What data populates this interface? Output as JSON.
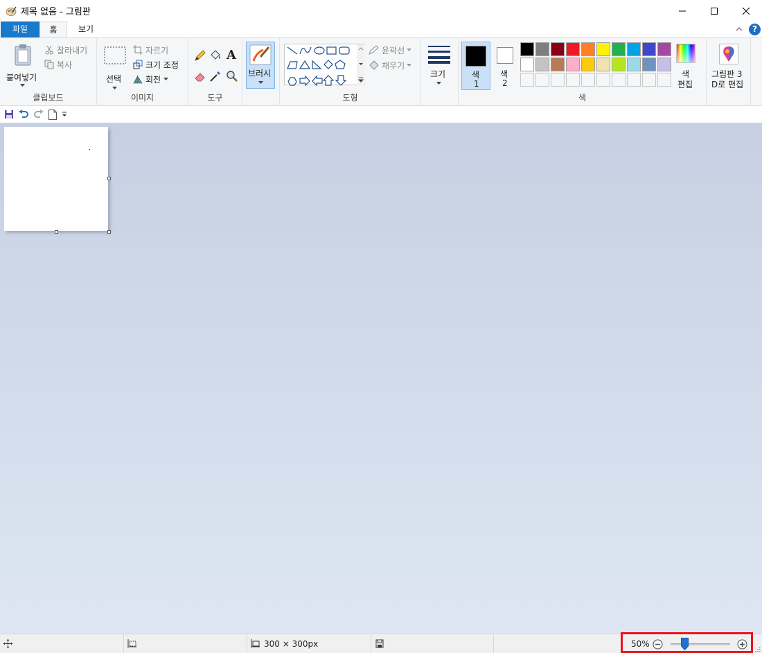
{
  "window": {
    "title": "제목 없음 - 그림판",
    "minimize_label": "—",
    "maximize_label": "☐",
    "close_label": "✕"
  },
  "tabs": [
    {
      "label": "파일"
    },
    {
      "label": "홈"
    },
    {
      "label": "보기"
    }
  ],
  "ribbon": {
    "clipboard": {
      "paste_label": "붙여넣기",
      "cut_label": "잘라내기",
      "copy_label": "복사",
      "group_label": "클립보드"
    },
    "image": {
      "select_label": "선택",
      "crop_label": "자르기",
      "resize_label": "크기 조정",
      "rotate_label": "회전",
      "group_label": "이미지"
    },
    "tools": {
      "text_label": "A",
      "group_label": "도구"
    },
    "brush": {
      "label": "브러시"
    },
    "shapes": {
      "outline_label": "윤곽선",
      "fill_label": "채우기",
      "group_label": "도형"
    },
    "size": {
      "label": "크기"
    },
    "colors": {
      "color1_label_a": "색",
      "color1_label_b": "1",
      "color2_label_a": "색",
      "color2_label_b": "2",
      "edit_colors_label_a": "색",
      "edit_colors_label_b": "편집",
      "group_label": "색",
      "color1_value": "#000000",
      "color2_value": "#ffffff",
      "palette_row1": [
        "#000000",
        "#7f7f7f",
        "#880015",
        "#ed1c24",
        "#ff7f27",
        "#fff200",
        "#22b14c",
        "#00a2e8",
        "#3f48cc",
        "#a349a4"
      ],
      "palette_row2": [
        "#ffffff",
        "#c3c3c3",
        "#b97a57",
        "#ffaec9",
        "#ffc90e",
        "#efe4b0",
        "#b5e61d",
        "#99d9ea",
        "#7092be",
        "#c8bfe7"
      ]
    },
    "paint3d": {
      "label_a": "그림판 3",
      "label_b": "D로 편집"
    }
  },
  "statusbar": {
    "canvas_size": "300 × 300px",
    "zoom_percent": "50%",
    "zoom_level": 0.5
  }
}
